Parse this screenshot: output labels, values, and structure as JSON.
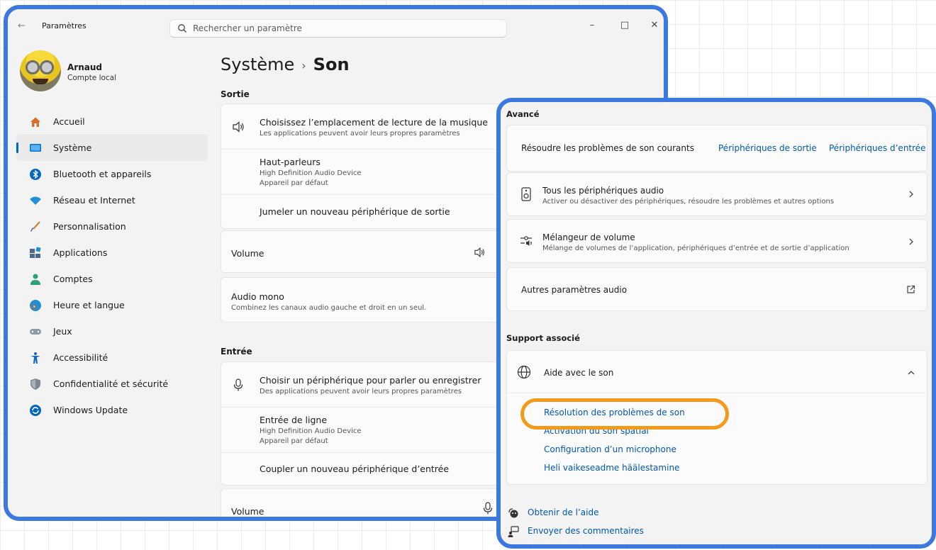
{
  "window": {
    "app_title": "Paramètres",
    "search_placeholder": "Rechercher un paramètre",
    "controls": [
      "–",
      "□",
      "✕"
    ]
  },
  "profile": {
    "name": "Arnaud",
    "account_type": "Compte local"
  },
  "sidebar": {
    "items": [
      {
        "label": "Accueil",
        "icon": "home-icon",
        "color": "#d86f2e"
      },
      {
        "label": "Système",
        "icon": "monitor-icon",
        "color": "#0078d4",
        "active": true
      },
      {
        "label": "Bluetooth et appareils",
        "icon": "bluetooth-icon",
        "color": "#0067c0"
      },
      {
        "label": "Réseau et Internet",
        "icon": "wifi-icon",
        "color": "#1f8fd6"
      },
      {
        "label": "Personnalisation",
        "icon": "brush-icon",
        "color": "#c9854a"
      },
      {
        "label": "Applications",
        "icon": "apps-icon",
        "color": "#4a6a8c"
      },
      {
        "label": "Comptes",
        "icon": "person-icon",
        "color": "#2aa17a"
      },
      {
        "label": "Heure et langue",
        "icon": "globe-clock-icon",
        "color": "#1f8fd6"
      },
      {
        "label": "Jeux",
        "icon": "gamepad-icon",
        "color": "#8f9aa5"
      },
      {
        "label": "Accessibilité",
        "icon": "accessibility-icon",
        "color": "#1565c0"
      },
      {
        "label": "Confidentialité et sécurité",
        "icon": "shield-icon",
        "color": "#7e8893"
      },
      {
        "label": "Windows Update",
        "icon": "update-icon",
        "color": "#0067c0"
      }
    ]
  },
  "breadcrumb": {
    "parent": "Système",
    "separator": "›",
    "current": "Son"
  },
  "output": {
    "section_title": "Sortie",
    "choose_location": {
      "title": "Choisissez l’emplacement de lecture de la musique",
      "subtitle": "Les applications peuvent avoir leurs propres paramètres"
    },
    "device": {
      "name": "Haut-parleurs",
      "detail1": "High Definition Audio Device",
      "detail2": "Appareil par défaut"
    },
    "pair_label": "Jumeler un nouveau périphérique de sortie",
    "volume_label": "Volume",
    "mono": {
      "title": "Audio mono",
      "subtitle": "Combinez les canaux audio gauche et droit en un seul."
    }
  },
  "input": {
    "section_title": "Entrée",
    "choose_device": {
      "title": "Choisir un périphérique pour parler ou enregistrer",
      "subtitle": "Des applications peuvent avoir leurs propres paramètres"
    },
    "device": {
      "name": "Entrée de ligne",
      "detail1": "High Definition Audio Device",
      "detail2": "Appareil par défaut"
    },
    "pair_label": "Coupler un nouveau périphérique d’entrée",
    "volume_label": "Volume"
  },
  "advanced": {
    "section_title": "Avancé",
    "troubleshoot": {
      "label": "Résoudre les problèmes de son courants",
      "link_output": "Périphériques de sortie",
      "link_input": "Périphériques d’entrée"
    },
    "all_devices": {
      "title": "Tous les périphériques audio",
      "subtitle": "Activer ou désactiver des périphériques, résoudre les problèmes et autres options"
    },
    "mixer": {
      "title": "Mélangeur de volume",
      "subtitle": "Mélange de volumes de l’application, périphériques d’entrée et de sortie d’application"
    },
    "more_settings": "Autres paramètres audio"
  },
  "support": {
    "section_title": "Support associé",
    "help_title": "Aide avec le son",
    "links": [
      "Résolution des problèmes de son",
      "Activation du son spatial",
      "Configuration d’un microphone",
      "Heli vaikeseadme häälestamine"
    ],
    "get_help": "Obtenir de l’aide",
    "feedback": "Envoyer des commentaires"
  },
  "colors": {
    "accent": "#3b78e0",
    "link": "#0058b0",
    "highlight": "#f39a1a"
  }
}
